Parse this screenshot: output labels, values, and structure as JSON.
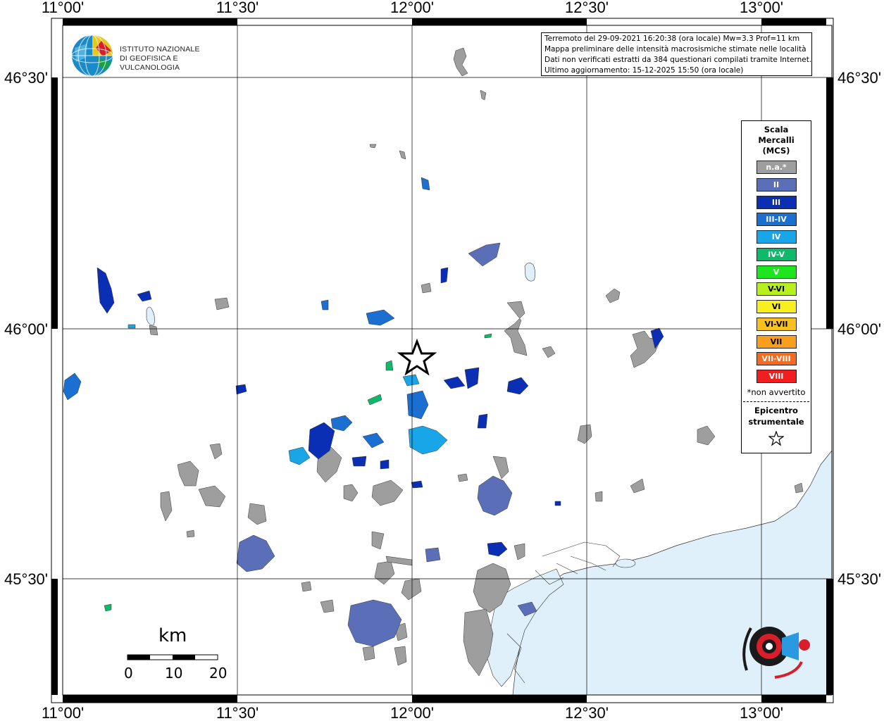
{
  "info": {
    "line1": "Terremoto del 29-09-2021 16:20:38 (ora locale) Mw=3.3 Prof=11 km",
    "line2": "Mappa preliminare delle intensità macrosismiche stimate nelle località",
    "line3": "Dati non verificati estratti da 384 questionari compilati tramite Internet.",
    "line4": "Ultimo aggiornamento: 15-12-2025 15:50 (ora locale)"
  },
  "logo": {
    "line1": "ISTITUTO NAZIONALE",
    "line2": "DI GEOFISICA E VULCANOLOGIA"
  },
  "axes": {
    "lon_labels": [
      "11°00'",
      "11°30'",
      "12°00'",
      "12°30'",
      "13°00'"
    ],
    "lat_labels": [
      "46°30'",
      "46°00'",
      "45°30'"
    ]
  },
  "legend": {
    "title_line1": "Scala",
    "title_line2": "Mercalli",
    "title_line3": "(MCS)",
    "items": [
      {
        "label": "n.a.*",
        "color": "#9e9e9e"
      },
      {
        "label": "II",
        "color": "#5a6fb8"
      },
      {
        "label": "III",
        "color": "#0a2fb5"
      },
      {
        "label": "III-IV",
        "color": "#1a6fd0"
      },
      {
        "label": "IV",
        "color": "#18a6e8"
      },
      {
        "label": "IV-V",
        "color": "#10b86a"
      },
      {
        "label": "V",
        "color": "#1ee61e"
      },
      {
        "label": "V-VI",
        "color": "#b8f01e"
      },
      {
        "label": "VI",
        "color": "#f8f01e"
      },
      {
        "label": "VI-VII",
        "color": "#f8c01e"
      },
      {
        "label": "VII",
        "color": "#f8a01e"
      },
      {
        "label": "VII-VIII",
        "color": "#f86a1e"
      },
      {
        "label": "VIII",
        "color": "#f01e1e"
      }
    ],
    "note": "*non avvertito",
    "epicenter_line1": "Epicentro",
    "epicenter_line2": "strumentale"
  },
  "scale_bar": {
    "unit": "km",
    "labels": [
      "0",
      "10",
      "20"
    ]
  },
  "colors": {
    "sea": "#dff0fb",
    "land": "#ffffff",
    "grid": "#000000"
  }
}
